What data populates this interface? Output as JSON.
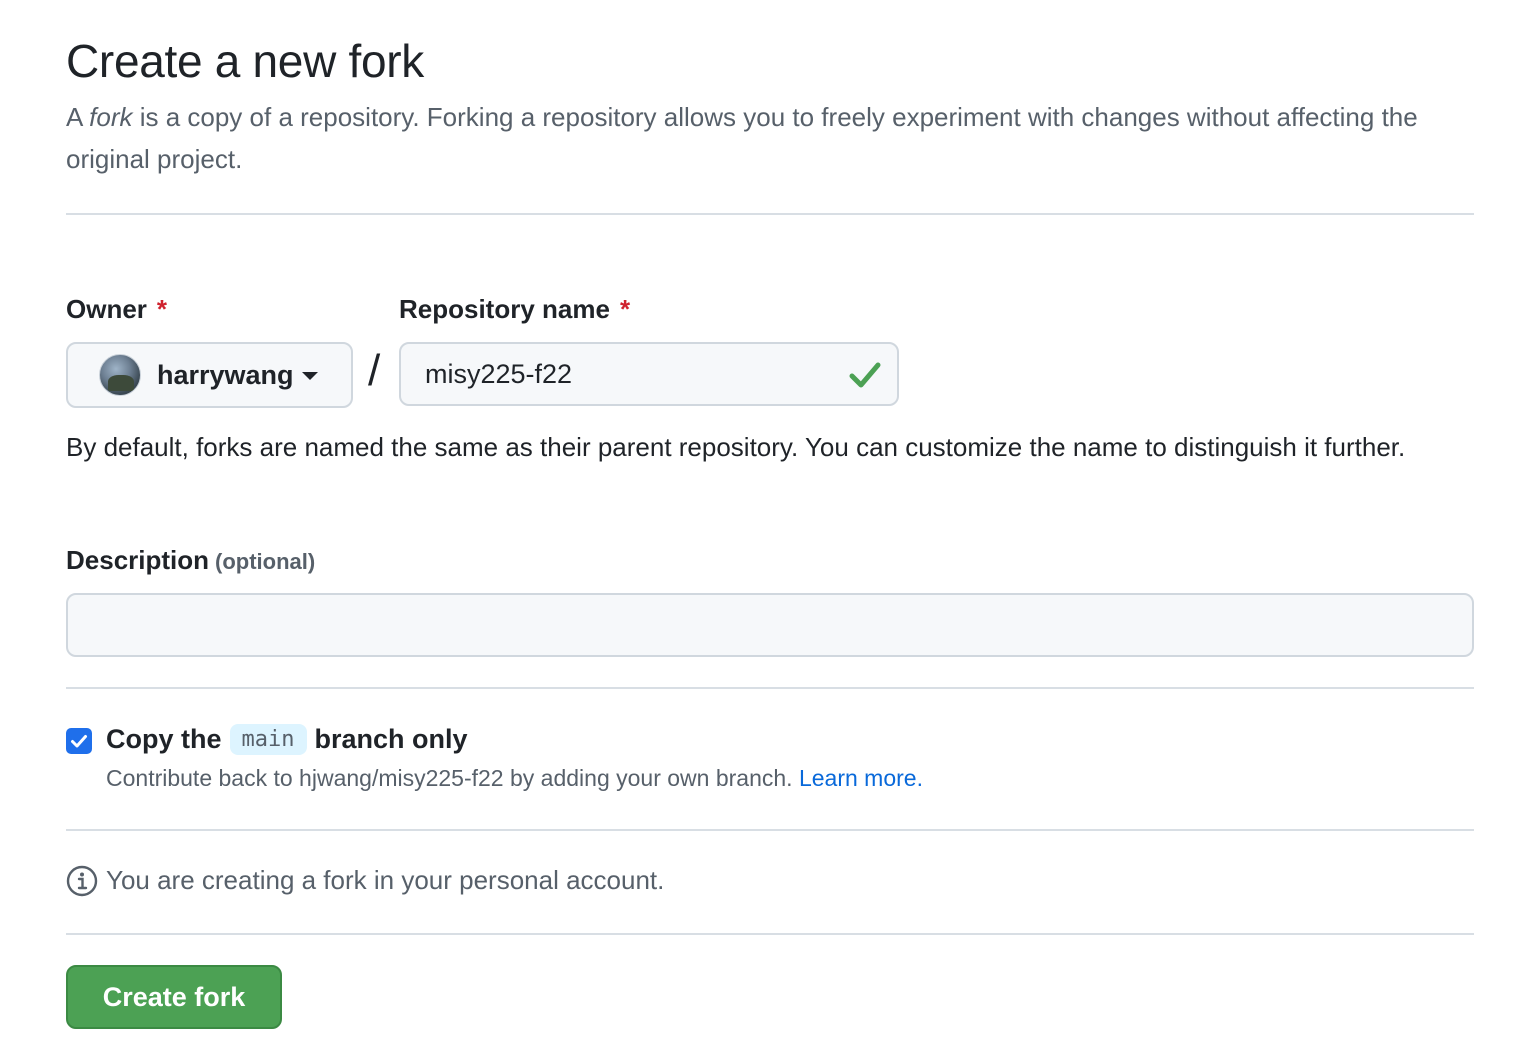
{
  "header": {
    "title": "Create a new fork",
    "subtitle_prefix": "A ",
    "subtitle_em": "fork",
    "subtitle_rest": " is a copy of a repository. Forking a repository allows you to freely experiment with changes without affecting the original project."
  },
  "owner": {
    "label": "Owner",
    "required_mark": "*",
    "value": "harrywang"
  },
  "repository": {
    "label": "Repository name",
    "required_mark": "*",
    "value": "misy225-f22",
    "valid": true
  },
  "separator": "/",
  "naming_help": "By default, forks are named the same as their parent repository. You can customize the name to distinguish it further.",
  "description": {
    "label": "Description",
    "optional": "(optional)",
    "value": ""
  },
  "copy_branch": {
    "checked": true,
    "label_before": "Copy the",
    "branch": "main",
    "label_after": "branch only",
    "note": "Contribute back to hjwang/misy225-f22 by adding your own branch.",
    "learn_more": "Learn more."
  },
  "info": {
    "text": "You are creating a fork in your personal account."
  },
  "actions": {
    "create_label": "Create fork"
  },
  "colors": {
    "primary_button": "#4ca154",
    "checkbox": "#1f6feb",
    "link": "#0969da",
    "required": "#cf222e",
    "valid_check": "#4ca154"
  }
}
